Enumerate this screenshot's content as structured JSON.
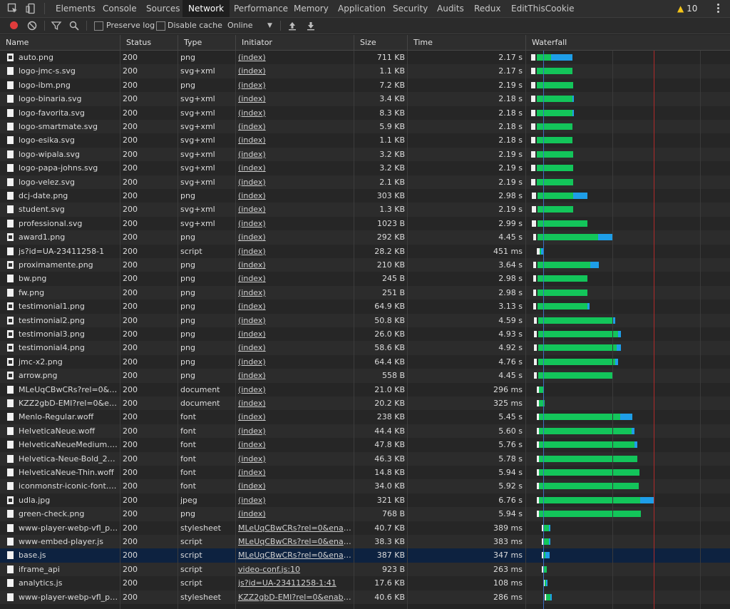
{
  "tabs": [
    "Elements",
    "Console",
    "Sources",
    "Network",
    "Performance",
    "Memory",
    "Application",
    "Security",
    "Audits",
    "Redux",
    "EditThisCookie"
  ],
  "active_tab": "Network",
  "warnings_count": "10",
  "toolbar": {
    "preserve_log": "Preserve log",
    "disable_cache": "Disable cache",
    "throttle": "Online"
  },
  "columns": {
    "name": "Name",
    "status": "Status",
    "type": "Type",
    "initiator": "Initiator",
    "size": "Size",
    "time": "Time",
    "waterfall": "Waterfall"
  },
  "colors": {
    "waiting": "#13c55a",
    "download": "#1e9ee8",
    "selected_row": "#0d2240"
  },
  "rows": [
    {
      "name": "auto.png",
      "status": "200",
      "type": "png",
      "initiator": "(index)",
      "size": "711 KB",
      "time": "2.17 s",
      "icon": "image"
    },
    {
      "name": "logo-jmc-s.svg",
      "status": "200",
      "type": "svg+xml",
      "initiator": "(index)",
      "size": "1.1 KB",
      "time": "2.17 s",
      "icon": "file"
    },
    {
      "name": "logo-ibm.png",
      "status": "200",
      "type": "png",
      "initiator": "(index)",
      "size": "7.2 KB",
      "time": "2.19 s",
      "icon": "file"
    },
    {
      "name": "logo-binaria.svg",
      "status": "200",
      "type": "svg+xml",
      "initiator": "(index)",
      "size": "3.4 KB",
      "time": "2.18 s",
      "icon": "file"
    },
    {
      "name": "logo-favorita.svg",
      "status": "200",
      "type": "svg+xml",
      "initiator": "(index)",
      "size": "8.3 KB",
      "time": "2.18 s",
      "icon": "file"
    },
    {
      "name": "logo-smartmate.svg",
      "status": "200",
      "type": "svg+xml",
      "initiator": "(index)",
      "size": "5.9 KB",
      "time": "2.18 s",
      "icon": "file"
    },
    {
      "name": "logo-esika.svg",
      "status": "200",
      "type": "svg+xml",
      "initiator": "(index)",
      "size": "1.1 KB",
      "time": "2.18 s",
      "icon": "file"
    },
    {
      "name": "logo-wipala.svg",
      "status": "200",
      "type": "svg+xml",
      "initiator": "(index)",
      "size": "3.2 KB",
      "time": "2.19 s",
      "icon": "file"
    },
    {
      "name": "logo-papa-johns.svg",
      "status": "200",
      "type": "svg+xml",
      "initiator": "(index)",
      "size": "3.2 KB",
      "time": "2.19 s",
      "icon": "file"
    },
    {
      "name": "logo-velez.svg",
      "status": "200",
      "type": "svg+xml",
      "initiator": "(index)",
      "size": "2.1 KB",
      "time": "2.19 s",
      "icon": "file"
    },
    {
      "name": "dcj-date.png",
      "status": "200",
      "type": "png",
      "initiator": "(index)",
      "size": "303 KB",
      "time": "2.98 s",
      "icon": "file"
    },
    {
      "name": "student.svg",
      "status": "200",
      "type": "svg+xml",
      "initiator": "(index)",
      "size": "1.3 KB",
      "time": "2.19 s",
      "icon": "file"
    },
    {
      "name": "professional.svg",
      "status": "200",
      "type": "svg+xml",
      "initiator": "(index)",
      "size": "1023 B",
      "time": "2.99 s",
      "icon": "file"
    },
    {
      "name": "award1.png",
      "status": "200",
      "type": "png",
      "initiator": "(index)",
      "size": "292 KB",
      "time": "4.45 s",
      "icon": "image"
    },
    {
      "name": "js?id=UA-23411258-1",
      "status": "200",
      "type": "script",
      "initiator": "(index)",
      "size": "28.2 KB",
      "time": "451 ms",
      "icon": "file"
    },
    {
      "name": "proximamente.png",
      "status": "200",
      "type": "png",
      "initiator": "(index)",
      "size": "210 KB",
      "time": "3.64 s",
      "icon": "image"
    },
    {
      "name": "bw.png",
      "status": "200",
      "type": "png",
      "initiator": "(index)",
      "size": "245 B",
      "time": "2.98 s",
      "icon": "file"
    },
    {
      "name": "fw.png",
      "status": "200",
      "type": "png",
      "initiator": "(index)",
      "size": "251 B",
      "time": "2.98 s",
      "icon": "file"
    },
    {
      "name": "testimonial1.png",
      "status": "200",
      "type": "png",
      "initiator": "(index)",
      "size": "64.9 KB",
      "time": "3.13 s",
      "icon": "image"
    },
    {
      "name": "testimonial2.png",
      "status": "200",
      "type": "png",
      "initiator": "(index)",
      "size": "50.8 KB",
      "time": "4.59 s",
      "icon": "image"
    },
    {
      "name": "testimonial3.png",
      "status": "200",
      "type": "png",
      "initiator": "(index)",
      "size": "26.0 KB",
      "time": "4.93 s",
      "icon": "image"
    },
    {
      "name": "testimonial4.png",
      "status": "200",
      "type": "png",
      "initiator": "(index)",
      "size": "58.6 KB",
      "time": "4.92 s",
      "icon": "image"
    },
    {
      "name": "jmc-x2.png",
      "status": "200",
      "type": "png",
      "initiator": "(index)",
      "size": "64.4 KB",
      "time": "4.76 s",
      "icon": "image"
    },
    {
      "name": "arrow.png",
      "status": "200",
      "type": "png",
      "initiator": "(index)",
      "size": "558 B",
      "time": "4.45 s",
      "icon": "image"
    },
    {
      "name": "MLeUqCBwCRs?rel=0&en...",
      "status": "200",
      "type": "document",
      "initiator": "(index)",
      "size": "21.0 KB",
      "time": "296 ms",
      "icon": "file"
    },
    {
      "name": "KZZ2gbD-EMI?rel=0&ena...",
      "status": "200",
      "type": "document",
      "initiator": "(index)",
      "size": "20.2 KB",
      "time": "325 ms",
      "icon": "file"
    },
    {
      "name": "Menlo-Regular.woff",
      "status": "200",
      "type": "font",
      "initiator": "(index)",
      "size": "238 KB",
      "time": "5.45 s",
      "icon": "file"
    },
    {
      "name": "HelveticaNeue.woff",
      "status": "200",
      "type": "font",
      "initiator": "(index)",
      "size": "44.4 KB",
      "time": "5.60 s",
      "icon": "file"
    },
    {
      "name": "HelveticaNeueMedium.woff",
      "status": "200",
      "type": "font",
      "initiator": "(index)",
      "size": "47.8 KB",
      "time": "5.76 s",
      "icon": "file"
    },
    {
      "name": "Helvetica-Neue-Bold_224...",
      "status": "200",
      "type": "font",
      "initiator": "(index)",
      "size": "46.3 KB",
      "time": "5.78 s",
      "icon": "file"
    },
    {
      "name": "HelveticaNeue-Thin.woff",
      "status": "200",
      "type": "font",
      "initiator": "(index)",
      "size": "14.8 KB",
      "time": "5.94 s",
      "icon": "file"
    },
    {
      "name": "iconmonstr-iconic-font.woff",
      "status": "200",
      "type": "font",
      "initiator": "(index)",
      "size": "34.0 KB",
      "time": "5.92 s",
      "icon": "file"
    },
    {
      "name": "udla.jpg",
      "status": "200",
      "type": "jpeg",
      "initiator": "(index)",
      "size": "321 KB",
      "time": "6.76 s",
      "icon": "image"
    },
    {
      "name": "green-check.png",
      "status": "200",
      "type": "png",
      "initiator": "(index)",
      "size": "768 B",
      "time": "5.94 s",
      "icon": "file"
    },
    {
      "name": "www-player-webp-vfl_pyg...",
      "status": "200",
      "type": "stylesheet",
      "initiator": "MLeUqCBwCRs?rel=0&enablej...",
      "size": "40.7 KB",
      "time": "389 ms",
      "icon": "file"
    },
    {
      "name": "www-embed-player.js",
      "status": "200",
      "type": "script",
      "initiator": "MLeUqCBwCRs?rel=0&enablej...",
      "size": "38.3 KB",
      "time": "383 ms",
      "icon": "file"
    },
    {
      "name": "base.js",
      "status": "200",
      "type": "script",
      "initiator": "MLeUqCBwCRs?rel=0&enablej...",
      "size": "387 KB",
      "time": "347 ms",
      "icon": "file",
      "selected": true
    },
    {
      "name": "iframe_api",
      "status": "200",
      "type": "script",
      "initiator": "video-conf.js:10",
      "size": "923 B",
      "time": "263 ms",
      "icon": "file"
    },
    {
      "name": "analytics.js",
      "status": "200",
      "type": "script",
      "initiator": "js?id=UA-23411258-1:41",
      "size": "17.6 KB",
      "time": "108 ms",
      "icon": "file"
    },
    {
      "name": "www-player-webp-vfl_pyg...",
      "status": "200",
      "type": "stylesheet",
      "initiator": "KZZ2gbD-EMI?rel=0&enablejs...",
      "size": "40.6 KB",
      "time": "286 ms",
      "icon": "file"
    }
  ],
  "waterfall": [
    {
      "q": [
        745,
        6
      ],
      "g": [
        753,
        20
      ],
      "b": [
        773,
        30
      ]
    },
    {
      "q": [
        745,
        6
      ],
      "g": [
        753,
        50
      ],
      "b": null
    },
    {
      "q": [
        745,
        6
      ],
      "g": [
        753,
        51
      ],
      "b": null
    },
    {
      "q": [
        745,
        6
      ],
      "g": [
        753,
        50
      ],
      "b": [
        803,
        2
      ]
    },
    {
      "q": [
        745,
        6
      ],
      "g": [
        753,
        50
      ],
      "b": [
        803,
        2
      ]
    },
    {
      "q": [
        745,
        6
      ],
      "g": [
        753,
        50
      ],
      "b": null
    },
    {
      "q": [
        745,
        6
      ],
      "g": [
        753,
        50
      ],
      "b": null
    },
    {
      "q": [
        745,
        6
      ],
      "g": [
        753,
        51
      ],
      "b": null
    },
    {
      "q": [
        745,
        6
      ],
      "g": [
        753,
        51
      ],
      "b": null
    },
    {
      "q": [
        745,
        6
      ],
      "g": [
        753,
        51
      ],
      "b": null
    },
    {
      "q": [
        746,
        6
      ],
      "g": [
        754,
        50
      ],
      "b": [
        804,
        20
      ]
    },
    {
      "q": [
        746,
        6
      ],
      "g": [
        754,
        50
      ],
      "b": null
    },
    {
      "q": [
        746,
        6
      ],
      "g": [
        754,
        70
      ],
      "b": null
    },
    {
      "q": [
        748,
        4
      ],
      "g": [
        754,
        85
      ],
      "b": [
        839,
        20
      ]
    },
    {
      "q": [
        753,
        4
      ],
      "g": [
        757,
        2
      ],
      "b": [
        759,
        4
      ]
    },
    {
      "q": [
        748,
        4
      ],
      "g": [
        754,
        74
      ],
      "b": [
        828,
        12
      ]
    },
    {
      "q": [
        748,
        4
      ],
      "g": [
        754,
        70
      ],
      "b": null
    },
    {
      "q": [
        748,
        4
      ],
      "g": [
        754,
        70
      ],
      "b": null
    },
    {
      "q": [
        748,
        4
      ],
      "g": [
        754,
        70
      ],
      "b": [
        824,
        3
      ]
    },
    {
      "q": [
        749,
        4
      ],
      "g": [
        755,
        104
      ],
      "b": [
        859,
        4
      ]
    },
    {
      "q": [
        749,
        4
      ],
      "g": [
        755,
        112
      ],
      "b": [
        867,
        4
      ]
    },
    {
      "q": [
        749,
        4
      ],
      "g": [
        755,
        110
      ],
      "b": [
        865,
        6
      ]
    },
    {
      "q": [
        749,
        4
      ],
      "g": [
        755,
        108
      ],
      "b": [
        863,
        4
      ]
    },
    {
      "q": [
        749,
        4
      ],
      "g": [
        755,
        104
      ],
      "b": null
    },
    {
      "q": [
        753,
        3
      ],
      "g": [
        756,
        6
      ],
      "b": null
    },
    {
      "q": [
        753,
        3
      ],
      "g": [
        756,
        8
      ],
      "b": null
    },
    {
      "q": [
        753,
        3
      ],
      "g": [
        756,
        114
      ],
      "b": [
        870,
        17
      ]
    },
    {
      "q": [
        753,
        3
      ],
      "g": [
        756,
        130
      ],
      "b": [
        886,
        4
      ]
    },
    {
      "q": [
        753,
        3
      ],
      "g": [
        756,
        134
      ],
      "b": [
        890,
        4
      ]
    },
    {
      "q": [
        753,
        3
      ],
      "g": [
        756,
        138
      ],
      "b": null
    },
    {
      "q": [
        753,
        3
      ],
      "g": [
        756,
        141
      ],
      "b": null
    },
    {
      "q": [
        753,
        3
      ],
      "g": [
        756,
        140
      ],
      "b": null
    },
    {
      "q": [
        753,
        3
      ],
      "g": [
        756,
        142
      ],
      "b": [
        898,
        20
      ]
    },
    {
      "q": [
        753,
        3
      ],
      "g": [
        756,
        143
      ],
      "b": null
    },
    {
      "q": [
        760,
        2
      ],
      "g": [
        762,
        8
      ],
      "b": [
        770,
        2
      ]
    },
    {
      "q": [
        760,
        2
      ],
      "g": [
        762,
        8
      ],
      "b": [
        770,
        2
      ]
    },
    {
      "q": [
        760,
        2
      ],
      "g": [
        762,
        3
      ],
      "b": [
        765,
        6
      ]
    },
    {
      "q": [
        760,
        2
      ],
      "g": [
        762,
        5
      ],
      "b": null
    },
    {
      "q": [
        762,
        2
      ],
      "g": [
        764,
        2
      ],
      "b": [
        766,
        2
      ]
    },
    {
      "q": [
        764,
        2
      ],
      "g": [
        766,
        6
      ],
      "b": [
        772,
        2
      ]
    }
  ]
}
